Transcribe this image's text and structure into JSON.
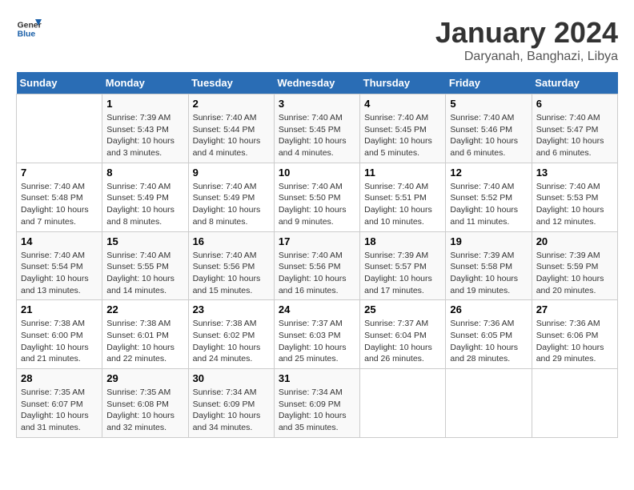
{
  "header": {
    "logo_line1": "General",
    "logo_line2": "Blue",
    "month": "January 2024",
    "location": "Daryanah, Banghazi, Libya"
  },
  "weekdays": [
    "Sunday",
    "Monday",
    "Tuesday",
    "Wednesday",
    "Thursday",
    "Friday",
    "Saturday"
  ],
  "weeks": [
    [
      {
        "day": "",
        "info": ""
      },
      {
        "day": "1",
        "info": "Sunrise: 7:39 AM\nSunset: 5:43 PM\nDaylight: 10 hours\nand 3 minutes."
      },
      {
        "day": "2",
        "info": "Sunrise: 7:40 AM\nSunset: 5:44 PM\nDaylight: 10 hours\nand 4 minutes."
      },
      {
        "day": "3",
        "info": "Sunrise: 7:40 AM\nSunset: 5:45 PM\nDaylight: 10 hours\nand 4 minutes."
      },
      {
        "day": "4",
        "info": "Sunrise: 7:40 AM\nSunset: 5:45 PM\nDaylight: 10 hours\nand 5 minutes."
      },
      {
        "day": "5",
        "info": "Sunrise: 7:40 AM\nSunset: 5:46 PM\nDaylight: 10 hours\nand 6 minutes."
      },
      {
        "day": "6",
        "info": "Sunrise: 7:40 AM\nSunset: 5:47 PM\nDaylight: 10 hours\nand 6 minutes."
      }
    ],
    [
      {
        "day": "7",
        "info": "Sunrise: 7:40 AM\nSunset: 5:48 PM\nDaylight: 10 hours\nand 7 minutes."
      },
      {
        "day": "8",
        "info": "Sunrise: 7:40 AM\nSunset: 5:49 PM\nDaylight: 10 hours\nand 8 minutes."
      },
      {
        "day": "9",
        "info": "Sunrise: 7:40 AM\nSunset: 5:49 PM\nDaylight: 10 hours\nand 8 minutes."
      },
      {
        "day": "10",
        "info": "Sunrise: 7:40 AM\nSunset: 5:50 PM\nDaylight: 10 hours\nand 9 minutes."
      },
      {
        "day": "11",
        "info": "Sunrise: 7:40 AM\nSunset: 5:51 PM\nDaylight: 10 hours\nand 10 minutes."
      },
      {
        "day": "12",
        "info": "Sunrise: 7:40 AM\nSunset: 5:52 PM\nDaylight: 10 hours\nand 11 minutes."
      },
      {
        "day": "13",
        "info": "Sunrise: 7:40 AM\nSunset: 5:53 PM\nDaylight: 10 hours\nand 12 minutes."
      }
    ],
    [
      {
        "day": "14",
        "info": "Sunrise: 7:40 AM\nSunset: 5:54 PM\nDaylight: 10 hours\nand 13 minutes."
      },
      {
        "day": "15",
        "info": "Sunrise: 7:40 AM\nSunset: 5:55 PM\nDaylight: 10 hours\nand 14 minutes."
      },
      {
        "day": "16",
        "info": "Sunrise: 7:40 AM\nSunset: 5:56 PM\nDaylight: 10 hours\nand 15 minutes."
      },
      {
        "day": "17",
        "info": "Sunrise: 7:40 AM\nSunset: 5:56 PM\nDaylight: 10 hours\nand 16 minutes."
      },
      {
        "day": "18",
        "info": "Sunrise: 7:39 AM\nSunset: 5:57 PM\nDaylight: 10 hours\nand 17 minutes."
      },
      {
        "day": "19",
        "info": "Sunrise: 7:39 AM\nSunset: 5:58 PM\nDaylight: 10 hours\nand 19 minutes."
      },
      {
        "day": "20",
        "info": "Sunrise: 7:39 AM\nSunset: 5:59 PM\nDaylight: 10 hours\nand 20 minutes."
      }
    ],
    [
      {
        "day": "21",
        "info": "Sunrise: 7:38 AM\nSunset: 6:00 PM\nDaylight: 10 hours\nand 21 minutes."
      },
      {
        "day": "22",
        "info": "Sunrise: 7:38 AM\nSunset: 6:01 PM\nDaylight: 10 hours\nand 22 minutes."
      },
      {
        "day": "23",
        "info": "Sunrise: 7:38 AM\nSunset: 6:02 PM\nDaylight: 10 hours\nand 24 minutes."
      },
      {
        "day": "24",
        "info": "Sunrise: 7:37 AM\nSunset: 6:03 PM\nDaylight: 10 hours\nand 25 minutes."
      },
      {
        "day": "25",
        "info": "Sunrise: 7:37 AM\nSunset: 6:04 PM\nDaylight: 10 hours\nand 26 minutes."
      },
      {
        "day": "26",
        "info": "Sunrise: 7:36 AM\nSunset: 6:05 PM\nDaylight: 10 hours\nand 28 minutes."
      },
      {
        "day": "27",
        "info": "Sunrise: 7:36 AM\nSunset: 6:06 PM\nDaylight: 10 hours\nand 29 minutes."
      }
    ],
    [
      {
        "day": "28",
        "info": "Sunrise: 7:35 AM\nSunset: 6:07 PM\nDaylight: 10 hours\nand 31 minutes."
      },
      {
        "day": "29",
        "info": "Sunrise: 7:35 AM\nSunset: 6:08 PM\nDaylight: 10 hours\nand 32 minutes."
      },
      {
        "day": "30",
        "info": "Sunrise: 7:34 AM\nSunset: 6:09 PM\nDaylight: 10 hours\nand 34 minutes."
      },
      {
        "day": "31",
        "info": "Sunrise: 7:34 AM\nSunset: 6:09 PM\nDaylight: 10 hours\nand 35 minutes."
      },
      {
        "day": "",
        "info": ""
      },
      {
        "day": "",
        "info": ""
      },
      {
        "day": "",
        "info": ""
      }
    ]
  ]
}
